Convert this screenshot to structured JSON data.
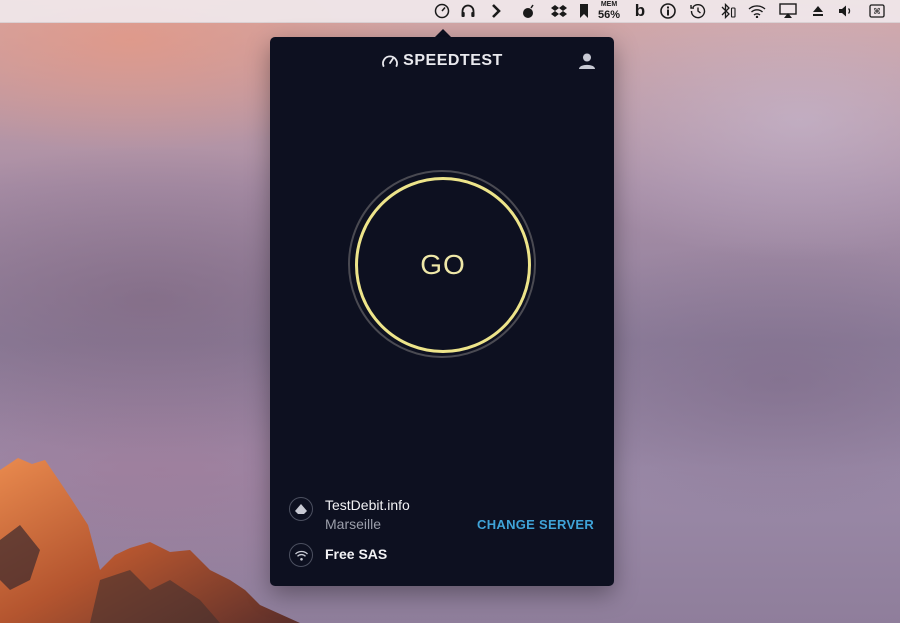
{
  "menubar": {
    "mem_label": "MEM",
    "mem_value": "56%",
    "icons": [
      "speedtest-icon",
      "headphones-icon",
      "chevron-right-icon",
      "bomb-icon",
      "dropbox-icon",
      "bookmark-icon",
      "mem-monitor",
      "b-icon",
      "info-icon",
      "time-machine-icon",
      "bluetooth-icon",
      "wifi-icon",
      "airplay-icon",
      "eject-icon",
      "volume-icon",
      "keyboard-icon"
    ]
  },
  "popup": {
    "brand": "SPEEDTEST",
    "go_label": "GO",
    "server_name": "TestDebit.info",
    "server_location": "Marseille",
    "change_server_label": "CHANGE SERVER",
    "isp_name": "Free SAS"
  },
  "colors": {
    "popup_bg": "#0d1020",
    "go_ring": "#ede48a",
    "change_server": "#3fa3d8"
  }
}
